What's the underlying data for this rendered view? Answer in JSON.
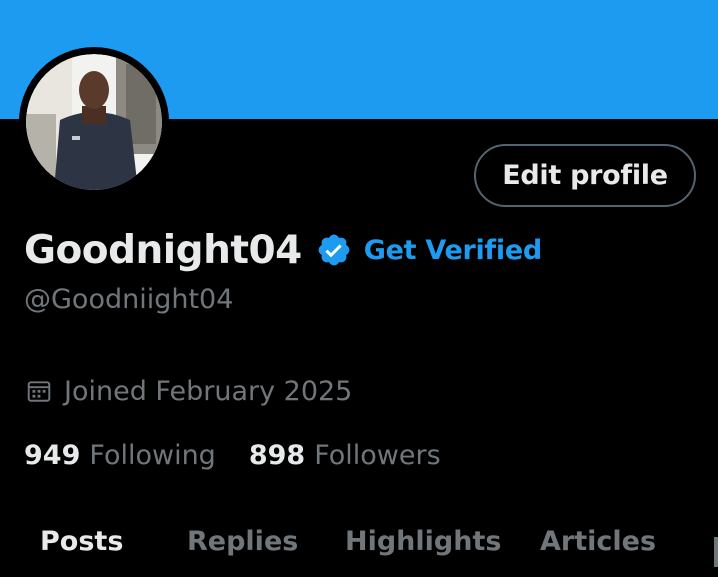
{
  "profile": {
    "display_name": "Goodnight04",
    "handle": "@Goodniight04",
    "get_verified_label": "Get Verified",
    "edit_profile_label": "Edit profile",
    "joined": "Joined February 2025"
  },
  "stats": {
    "following_count": "949",
    "following_label": "Following",
    "followers_count": "898",
    "followers_label": "Followers"
  },
  "tabs": [
    {
      "label": "Posts",
      "active": true
    },
    {
      "label": "Replies",
      "active": false
    },
    {
      "label": "Highlights",
      "active": false
    },
    {
      "label": "Articles",
      "active": false
    }
  ],
  "colors": {
    "banner": "#1d9bf0",
    "background": "#000000",
    "accent": "#1d9bf0",
    "primary_text": "#e7e9ea",
    "secondary_text": "#71767b"
  },
  "icons": {
    "verified": "verified-badge-icon",
    "calendar": "calendar-icon"
  }
}
